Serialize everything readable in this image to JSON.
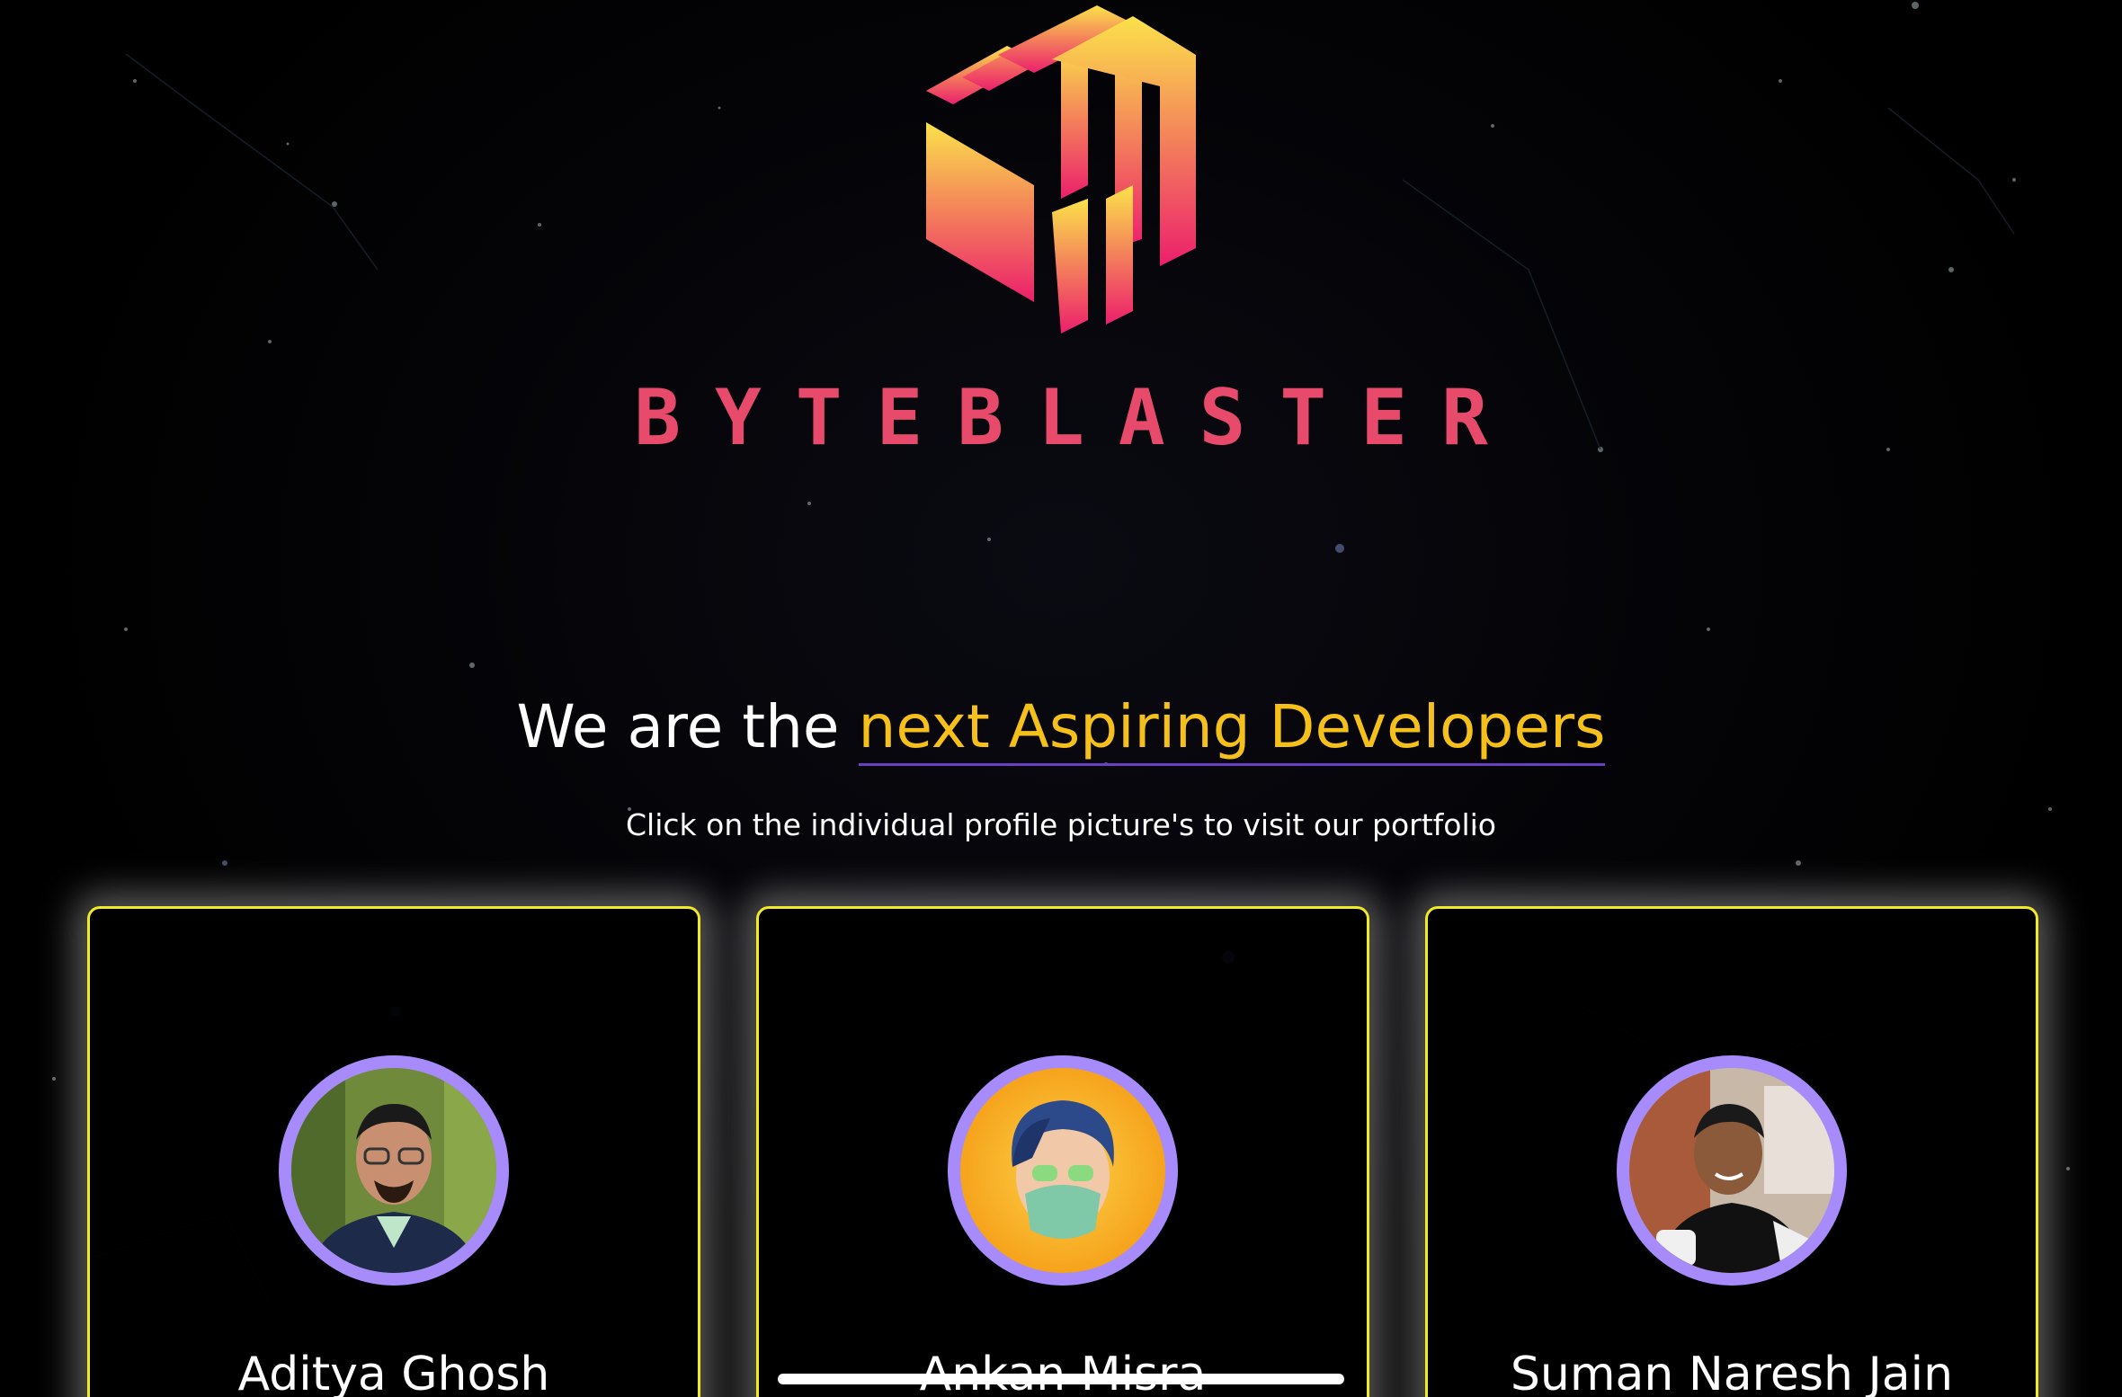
{
  "brand": {
    "name": "BYTEBLASTER",
    "colors": {
      "gradient_top": "#fbe24a",
      "gradient_bottom": "#ec1f6c",
      "wordmark": "#e84a6b"
    }
  },
  "hero": {
    "headline_prefix": "We are the ",
    "headline_accent": "next Aspiring Developers",
    "subtitle": "Click on the individual profile picture's to visit our portfolio",
    "colors": {
      "accent": "#f5c01a",
      "underline": "#6a3fc4"
    }
  },
  "team": [
    {
      "name": "Aditya Ghosh"
    },
    {
      "name": "Ankan Misra"
    },
    {
      "name": "Suman Naresh Jain"
    }
  ],
  "card_colors": {
    "border": "#f0ea2a",
    "avatar_ring": "#a78bfa"
  }
}
